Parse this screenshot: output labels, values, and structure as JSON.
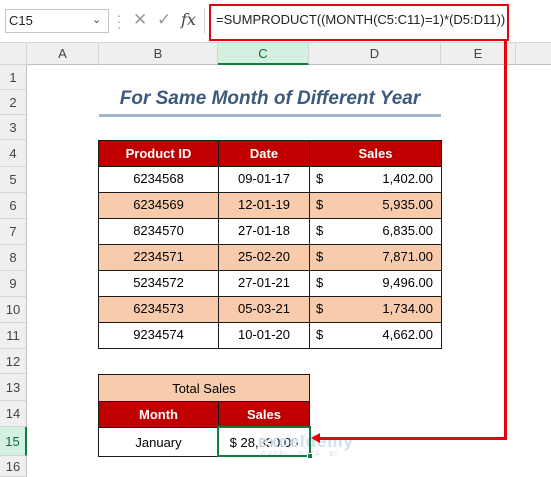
{
  "formula_bar": {
    "name_box": "C15",
    "cancel_icon": "✕",
    "enter_icon": "✓",
    "fx_label": "fx",
    "formula": "=SUMPRODUCT((MONTH(C5:C11)=1)*(D5:D11))"
  },
  "columns": [
    "A",
    "B",
    "C",
    "D",
    "E"
  ],
  "rows": [
    "1",
    "2",
    "3",
    "4",
    "5",
    "6",
    "7",
    "8",
    "9",
    "10",
    "11",
    "12",
    "13",
    "14",
    "15",
    "16"
  ],
  "title": "For Same Month of Different Year",
  "table": {
    "headers": [
      "Product ID",
      "Date",
      "Sales"
    ],
    "rows": [
      {
        "id": "6234568",
        "date": "09-01-17",
        "dollar": "$",
        "sales": "1,402.00"
      },
      {
        "id": "6234569",
        "date": "12-01-19",
        "dollar": "$",
        "sales": "5,935.00"
      },
      {
        "id": "8234570",
        "date": "27-01-18",
        "dollar": "$",
        "sales": "6,835.00"
      },
      {
        "id": "2234571",
        "date": "25-02-20",
        "dollar": "$",
        "sales": "7,871.00"
      },
      {
        "id": "5234572",
        "date": "27-01-21",
        "dollar": "$",
        "sales": "9,496.00"
      },
      {
        "id": "6234573",
        "date": "05-03-21",
        "dollar": "$",
        "sales": "1,734.00"
      },
      {
        "id": "9234574",
        "date": "10-01-20",
        "dollar": "$",
        "sales": "4,662.00"
      }
    ]
  },
  "summary": {
    "title": "Total Sales",
    "headers": [
      "Month",
      "Sales"
    ],
    "month": "January",
    "sales": "$ 28,330.00"
  },
  "watermark": {
    "text": "exceldemy",
    "sub": "EXCEL · DATA · BI"
  },
  "colors": {
    "header_red": "#c00000",
    "peach": "#f8cbad",
    "annotation_red": "#e8000b",
    "selection_green": "#107c41"
  }
}
